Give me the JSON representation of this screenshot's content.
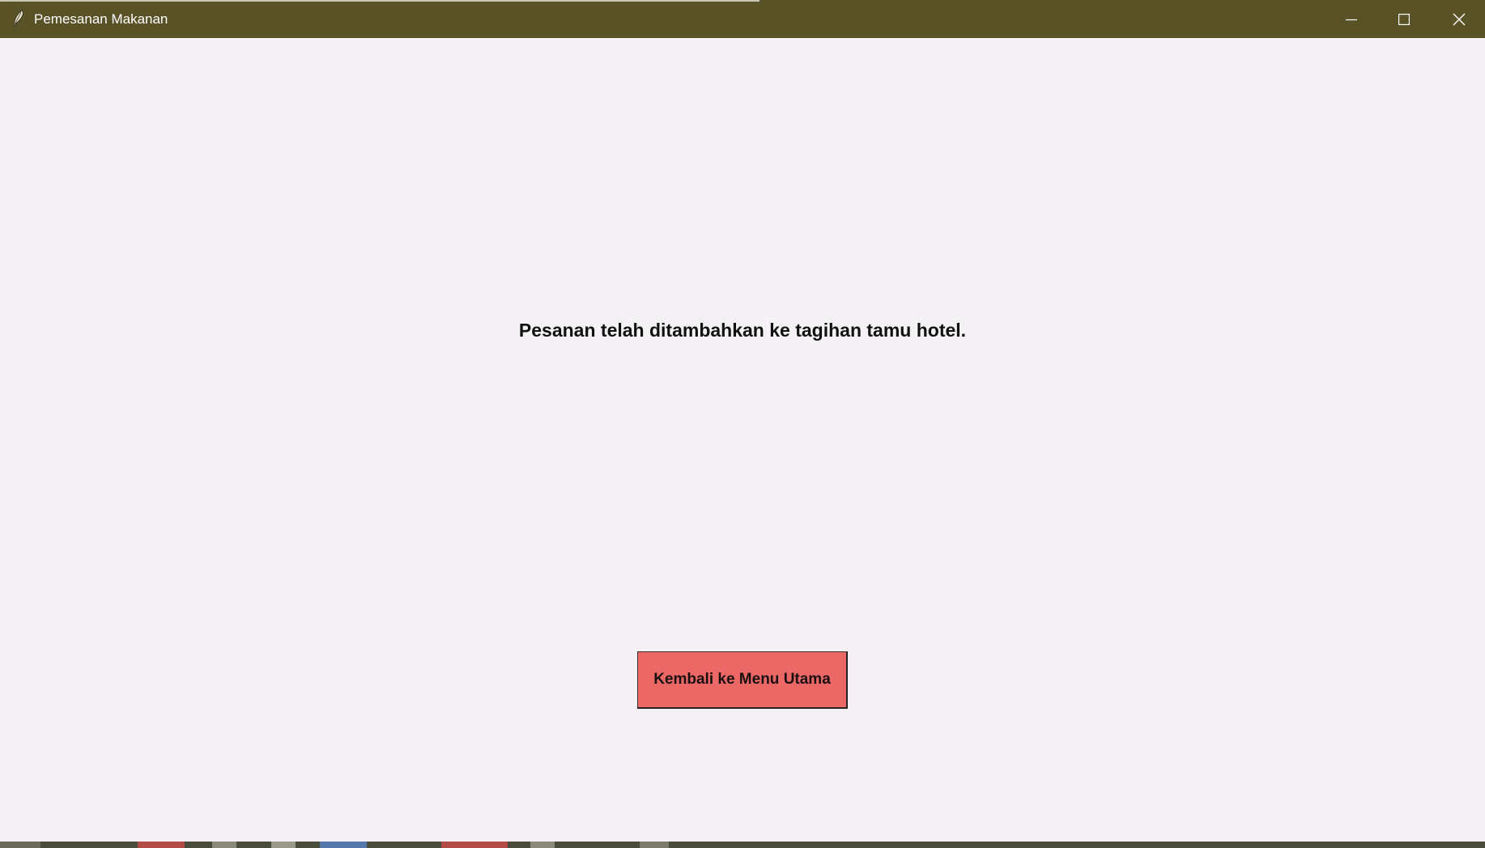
{
  "window": {
    "title": "Pemesanan Makanan",
    "titlebar_color": "#595227",
    "app_icon": "feather-icon",
    "controls": {
      "minimize_icon": "minimize-icon",
      "maximize_icon": "maximize-icon",
      "close_icon": "close-icon"
    }
  },
  "main": {
    "message": "Pesanan telah ditambahkan ke tagihan tamu hotel.",
    "back_button_label": "Kembali ke Menu Utama",
    "back_button_color": "#ec6866",
    "background_color": "#f5f2f6"
  }
}
